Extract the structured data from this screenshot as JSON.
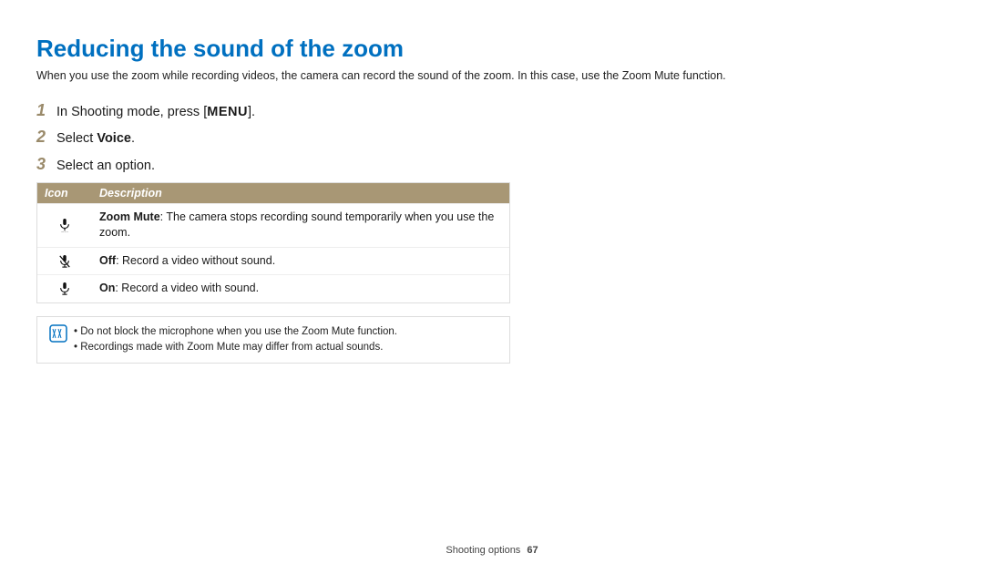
{
  "title": "Reducing the sound of the zoom",
  "intro": "When you use the zoom while recording videos, the camera can record the sound of the zoom. In this case, use the Zoom Mute function.",
  "steps": {
    "s1": {
      "num": "1",
      "pre": "In Shooting mode, press [",
      "key": "MENU",
      "post": "]."
    },
    "s2": {
      "num": "2",
      "pre": "Select ",
      "bold": "Voice",
      "post": "."
    },
    "s3": {
      "num": "3",
      "text": "Select an option."
    }
  },
  "table": {
    "head": {
      "icon": "Icon",
      "desc": "Description"
    },
    "rows": [
      {
        "bold": "Zoom Mute",
        "rest": ": The camera stops recording sound temporarily when you use the zoom."
      },
      {
        "bold": "Off",
        "rest": ": Record a video without sound."
      },
      {
        "bold": "On",
        "rest": ": Record a video with sound."
      }
    ]
  },
  "notes": [
    "Do not block the microphone when you use the Zoom Mute function.",
    "Recordings made with Zoom Mute may differ from actual sounds."
  ],
  "footer": {
    "section": "Shooting options",
    "page": "67"
  }
}
